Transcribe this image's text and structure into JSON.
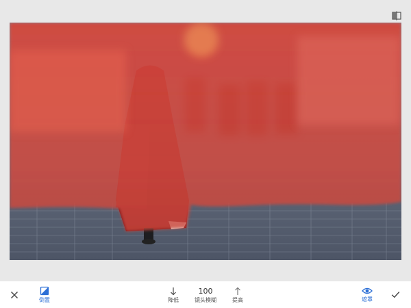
{
  "toolbar": {
    "cancel_icon": "close-icon",
    "invert_label": "倒置",
    "invert_icon": "invert-mask-icon",
    "decrease_label": "降低",
    "decrease_icon": "arrow-down-icon",
    "param_value": "100",
    "param_label": "镜头模糊",
    "increase_label": "提高",
    "increase_icon": "arrow-up-icon",
    "mask_label": "遮罩",
    "mask_icon": "eye-icon",
    "apply_icon": "check-icon"
  },
  "header": {
    "compare_icon": "compare-icon"
  },
  "colors": {
    "accent": "#2c6fd6",
    "mask_overlay": "#d5463b",
    "background": "#e8e8e8",
    "toolbar_bg": "#ffffff"
  }
}
